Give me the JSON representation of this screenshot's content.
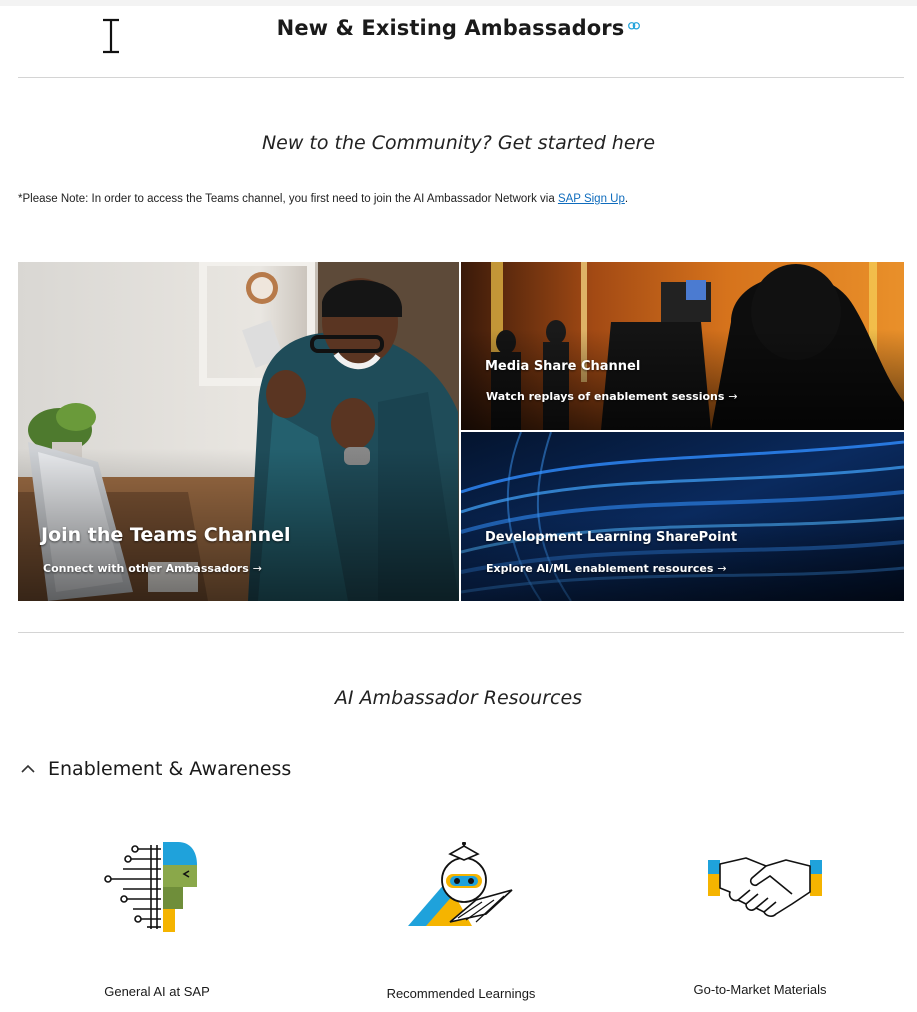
{
  "header": {
    "title": "New & Existing Ambassadors"
  },
  "intro": {
    "heading": "New to the Community? Get started here",
    "note_prefix": "*Please Note: In order to access the Teams channel, you first need to join the AI Ambassador Network via ",
    "note_link": "SAP Sign Up",
    "note_suffix": "."
  },
  "tiles": [
    {
      "title": "Join the Teams Channel",
      "link": "Connect with other Ambassadors"
    },
    {
      "title": "Media Share Channel",
      "link": "Watch replays of enablement sessions"
    },
    {
      "title": "Development Learning SharePoint",
      "link": "Explore AI/ML enablement resources"
    }
  ],
  "resources": {
    "heading": "AI Ambassador Resources",
    "section_label": "Enablement & Awareness",
    "items": [
      {
        "label": "General AI at SAP",
        "icon": "ai-head-icon"
      },
      {
        "label": "Recommended Learnings",
        "icon": "learning-robot-icon"
      },
      {
        "label": "Go-to-Market Materials",
        "icon": "handshake-icon"
      }
    ]
  },
  "colors": {
    "link": "#0f6cbd",
    "accent_blue": "#1fa2db",
    "accent_yellow": "#f5b400",
    "accent_green": "#8aa84a"
  }
}
